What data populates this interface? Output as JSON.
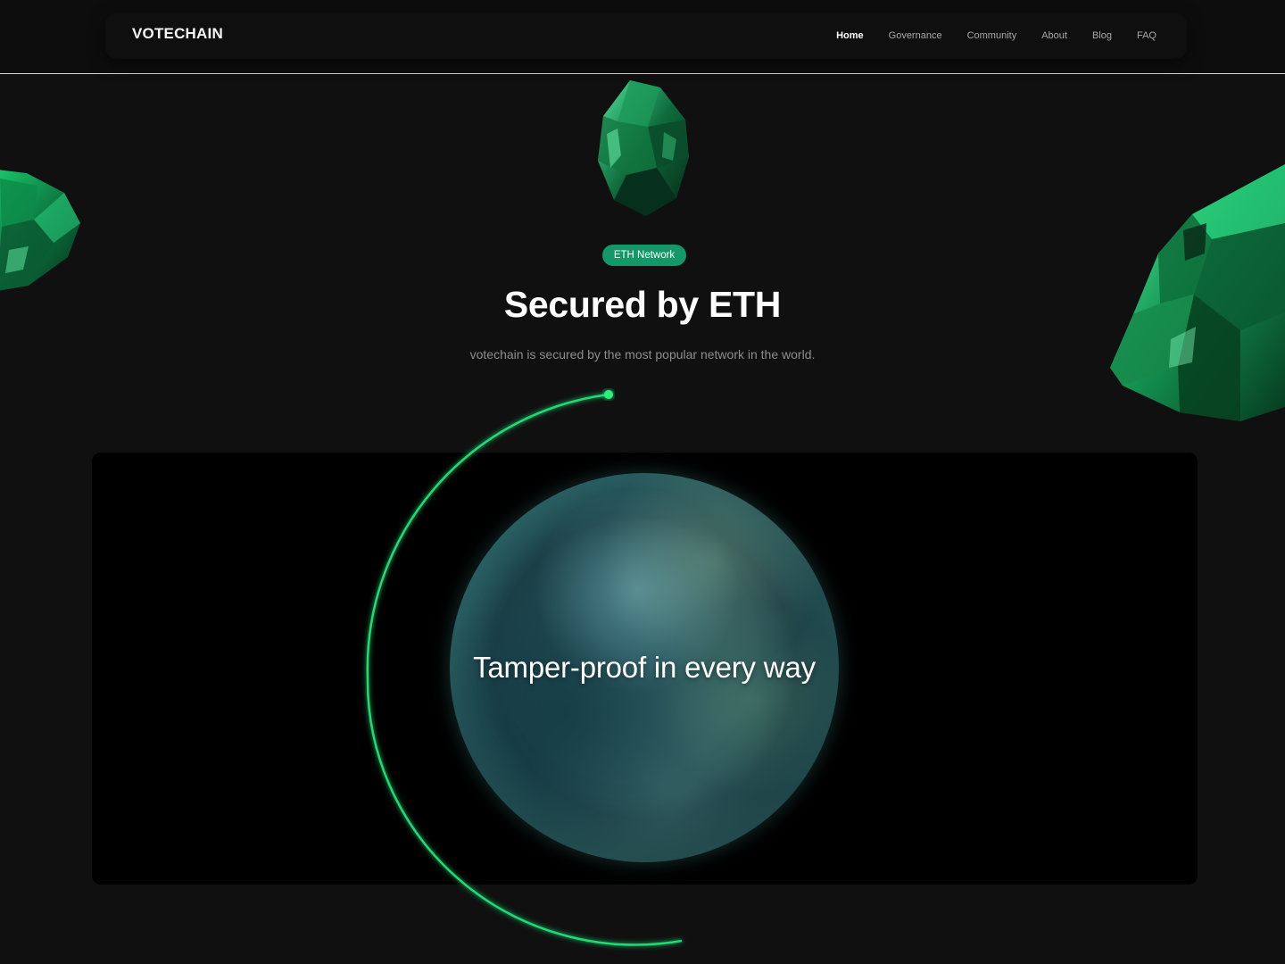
{
  "header": {
    "brand": "VOTECHAIN",
    "nav": [
      "Home",
      "Governance",
      "Community",
      "About",
      "Blog",
      "FAQ"
    ],
    "active_item": "Home"
  },
  "hero": {
    "badge": "ETH Network",
    "title": "Secured by ETH",
    "subtitle": "votechain is secured by the most popular network in the world."
  },
  "panel": {
    "planet_text": "Tamper-proof in every way"
  },
  "colors": {
    "background": "#101010",
    "accent": "#13986a",
    "orbit": "#1fdc76",
    "panel": "#000000"
  },
  "icons": [
    "gem-top-icon",
    "gem-left-icon",
    "gem-right-icon",
    "planet-image",
    "orbit-arc"
  ]
}
